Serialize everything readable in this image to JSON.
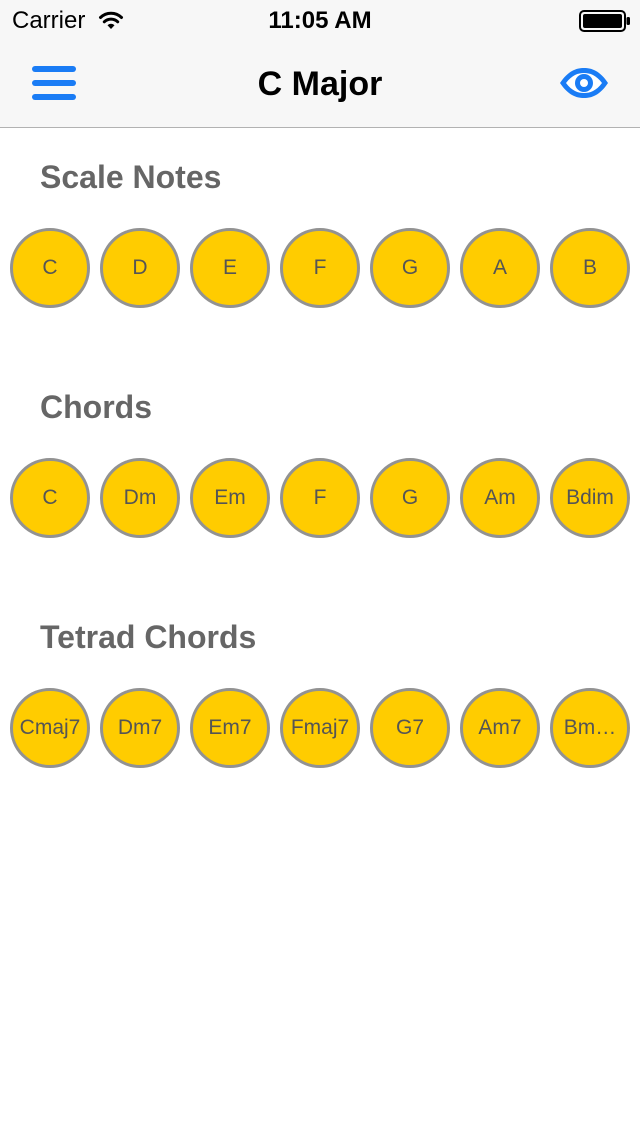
{
  "status_bar": {
    "carrier": "Carrier",
    "time": "11:05 AM"
  },
  "nav": {
    "title": "C Major",
    "menu_icon": "hamburger-menu-icon",
    "eye_icon": "eye-icon"
  },
  "colors": {
    "accent": "#1a7cf5",
    "circle_fill": "#ffcc00",
    "circle_border": "#929292",
    "section_title": "#666666"
  },
  "sections": [
    {
      "title": "Scale Notes",
      "items": [
        "C",
        "D",
        "E",
        "F",
        "G",
        "A",
        "B"
      ]
    },
    {
      "title": "Chords",
      "items": [
        "C",
        "Dm",
        "Em",
        "F",
        "G",
        "Am",
        "Bdim"
      ]
    },
    {
      "title": "Tetrad Chords",
      "items": [
        "Cmaj7",
        "Dm7",
        "Em7",
        "Fmaj7",
        "G7",
        "Am7",
        "Bm…"
      ]
    }
  ]
}
